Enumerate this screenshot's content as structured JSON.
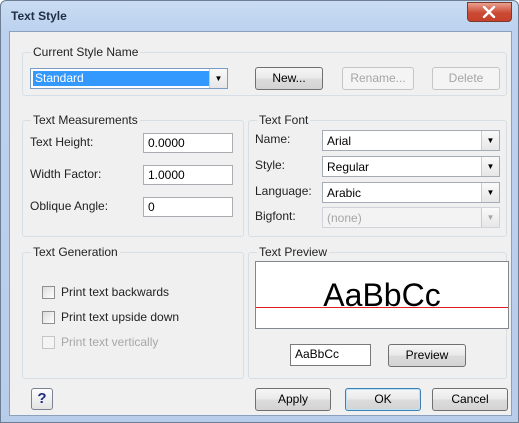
{
  "window": {
    "title": "Text Style"
  },
  "current_style": {
    "group_label": "Current Style Name",
    "selected": "Standard",
    "new_label": "New...",
    "rename_label": "Rename...",
    "delete_label": "Delete"
  },
  "measurements": {
    "group_label": "Text Measurements",
    "height_label": "Text Height:",
    "height_value": "0.0000",
    "width_label": "Width Factor:",
    "width_value": "1.0000",
    "oblique_label": "Oblique Angle:",
    "oblique_value": "0"
  },
  "font": {
    "group_label": "Text Font",
    "name_label": "Name:",
    "name_value": "Arial",
    "style_label": "Style:",
    "style_value": "Regular",
    "language_label": "Language:",
    "language_value": "Arabic",
    "bigfont_label": "Bigfont:",
    "bigfont_value": "(none)"
  },
  "generation": {
    "group_label": "Text Generation",
    "backwards_label": "Print text backwards",
    "backwards_checked": false,
    "upside_label": "Print text upside down",
    "upside_checked": false,
    "vertical_label": "Print text vertically",
    "vertical_checked": false
  },
  "preview": {
    "group_label": "Text Preview",
    "sample_text": "AaBbCc",
    "input_value": "AaBbCc",
    "button_label": "Preview"
  },
  "footer": {
    "help_label": "?",
    "apply_label": "Apply",
    "ok_label": "OK",
    "cancel_label": "Cancel"
  },
  "colors": {
    "preview_baseline": "#e02020",
    "selection": "#3399ff",
    "close_button": "#c7402b"
  },
  "icons": {
    "close": "close-icon",
    "dropdown": "chevron-down-icon",
    "help": "help-icon"
  }
}
